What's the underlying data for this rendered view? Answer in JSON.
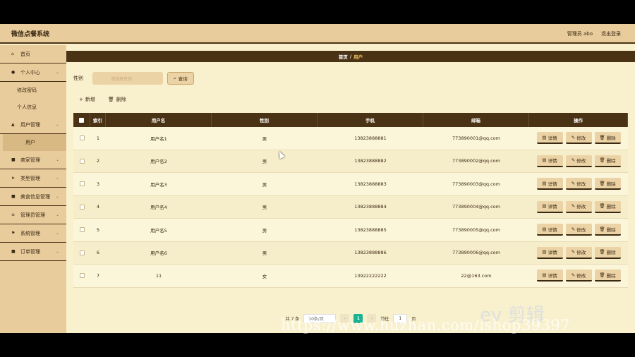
{
  "app": {
    "title": "微信点餐系统"
  },
  "topbar": {
    "user": "管理员 abo",
    "logout": "退出登录"
  },
  "sidebar": {
    "items": [
      {
        "icon": "home-icon",
        "glyph": "⌂",
        "label": "首页",
        "has_chevron": false
      },
      {
        "icon": "user-icon",
        "glyph": "●",
        "label": "个人中心",
        "has_chevron": true
      },
      {
        "label": "修改密码",
        "sub": true
      },
      {
        "label": "个人信息",
        "sub": true
      },
      {
        "icon": "users-icon",
        "glyph": "▲",
        "label": "用户管理",
        "has_chevron": true
      },
      {
        "label": "用户",
        "sub": true,
        "active": true
      },
      {
        "icon": "grid-icon",
        "glyph": "■",
        "label": "商家管理",
        "has_chevron": true
      },
      {
        "icon": "send-icon",
        "glyph": "➤",
        "label": "类型管理",
        "has_chevron": true
      },
      {
        "icon": "grid-icon",
        "glyph": "■",
        "label": "美食信息管理",
        "has_chevron": true
      },
      {
        "icon": "settings-icon",
        "glyph": "≡",
        "label": "管理员管理",
        "has_chevron": true
      },
      {
        "icon": "flag-icon",
        "glyph": "⚑",
        "label": "系统管理",
        "has_chevron": true
      },
      {
        "icon": "grid-icon",
        "glyph": "■",
        "label": "订单管理",
        "has_chevron": true
      }
    ]
  },
  "breadcrumb": {
    "home": "首页",
    "sep": "/",
    "current": "用户"
  },
  "search": {
    "label": "性别",
    "placeholder": "请选择性别",
    "button": "查询"
  },
  "actions": {
    "add": "新增",
    "delete": "删除"
  },
  "table": {
    "headers": [
      "索引",
      "用户名",
      "性别",
      "手机",
      "邮箱",
      "操作"
    ],
    "rows": [
      {
        "idx": "1",
        "name": "用户名1",
        "sex": "男",
        "tel": "13823888881",
        "mail": "773890001@qq.com"
      },
      {
        "idx": "2",
        "name": "用户名2",
        "sex": "男",
        "tel": "13823888882",
        "mail": "773890002@qq.com"
      },
      {
        "idx": "3",
        "name": "用户名3",
        "sex": "男",
        "tel": "13823888883",
        "mail": "773890003@qq.com"
      },
      {
        "idx": "4",
        "name": "用户名4",
        "sex": "男",
        "tel": "13823888884",
        "mail": "773890004@qq.com"
      },
      {
        "idx": "5",
        "name": "用户名5",
        "sex": "男",
        "tel": "13823888885",
        "mail": "773890005@qq.com"
      },
      {
        "idx": "6",
        "name": "用户名6",
        "sex": "男",
        "tel": "13823888886",
        "mail": "773890006@qq.com"
      },
      {
        "idx": "7",
        "name": "11",
        "sex": "女",
        "tel": "13922222222",
        "mail": "22@163.com"
      }
    ],
    "op_detail": "详情",
    "op_edit": "修改",
    "op_delete": "删除"
  },
  "pager": {
    "total": "共 7 条",
    "size": "10条/页",
    "page": "1",
    "goto": "前往",
    "goto_value": "1",
    "unit": "页"
  },
  "watermark": {
    "url": "https://www.huzhan.com/ishop39397",
    "ev": "ev 剪辑"
  },
  "colors": {
    "brown": "#4a3214",
    "sand": "#e9cc9c",
    "cream": "#f9f1cd",
    "accent": "#19b394"
  }
}
